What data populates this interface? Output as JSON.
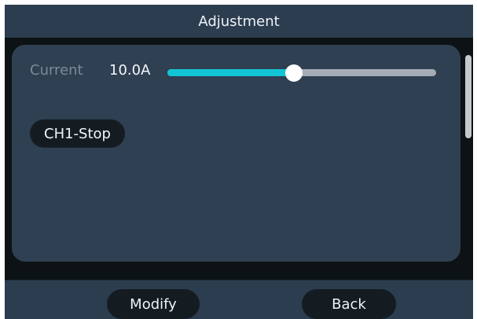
{
  "header": {
    "title": "Adjustment"
  },
  "main": {
    "current": {
      "label": "Current",
      "value": "10.0A",
      "slider_level": 0.47
    },
    "stop_button": {
      "label": "CH1-Stop"
    }
  },
  "footer": {
    "modify_label": "Modify",
    "back_label": "Back"
  },
  "colors": {
    "background": "#0d1215",
    "bar": "#2b3d4f",
    "panel": "#2f4052",
    "accent": "#12c4d4",
    "button": "#141c22"
  }
}
